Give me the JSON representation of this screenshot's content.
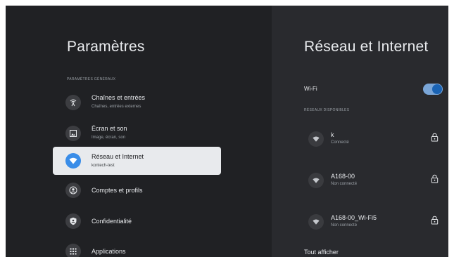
{
  "left": {
    "title": "Paramètres",
    "section_header": "PARAMÈTRES GÉNÉRAUX",
    "items": [
      {
        "label": "Chaînes et entrées",
        "sub": "Chaînes, entrées externes",
        "icon": "antenna-icon"
      },
      {
        "label": "Écran et son",
        "sub": "Image, écran, son",
        "icon": "image-icon"
      },
      {
        "label": "Réseau et Internet",
        "sub": "kontech-test",
        "icon": "wifi-icon",
        "selected": true
      },
      {
        "label": "Comptes et profils",
        "sub": "",
        "icon": "account-icon"
      },
      {
        "label": "Confidentialité",
        "sub": "",
        "icon": "shield-icon"
      },
      {
        "label": "Applications",
        "sub": "",
        "icon": "apps-grid-icon"
      }
    ]
  },
  "right": {
    "title": "Réseau et Internet",
    "wifi_label": "Wi-Fi",
    "wifi_enabled": true,
    "section_header": "RÉSEAUX DISPONIBLES",
    "networks": [
      {
        "name": "k",
        "status": "Connecté",
        "secured": true
      },
      {
        "name": "A168-00",
        "status": "Non connecté",
        "secured": true
      },
      {
        "name": "A168-00_Wi-Fi5",
        "status": "Non connecté",
        "secured": true
      }
    ],
    "show_all": "Tout afficher"
  },
  "colors": {
    "left_bg": "#202124",
    "right_bg": "#292a2e",
    "accent": "#3a8de8",
    "toggle_track": "#7aa6d8",
    "toggle_knob": "#1a63b4"
  }
}
